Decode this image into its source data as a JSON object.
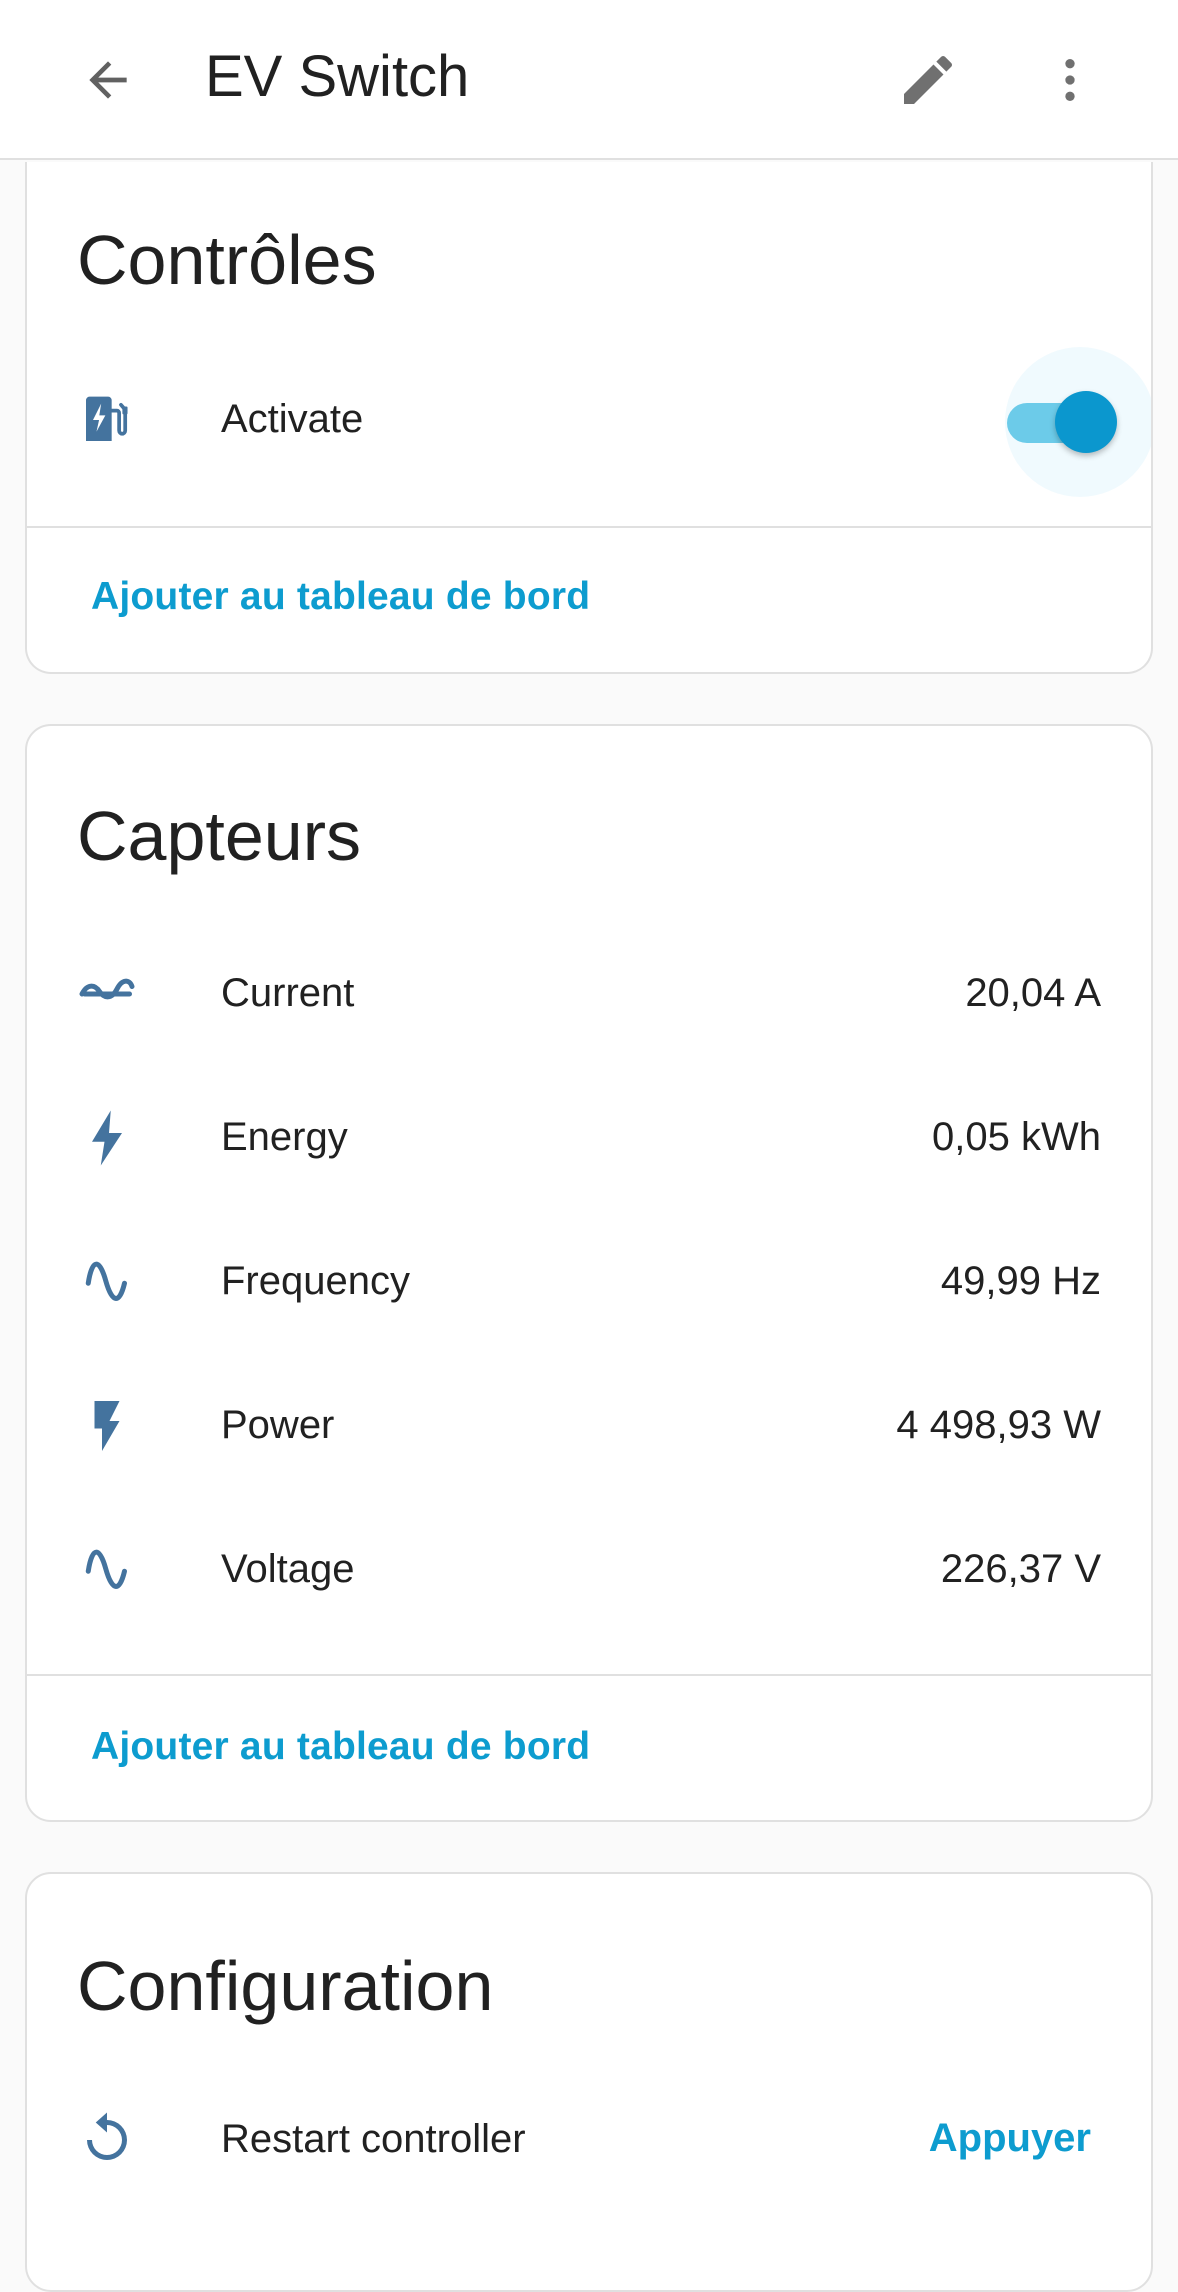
{
  "header": {
    "title": "EV Switch",
    "back_icon": "arrow-left-icon",
    "edit_icon": "pencil-icon",
    "more_icon": "dots-vertical-icon"
  },
  "colors": {
    "accent": "#0d9ccf",
    "icon": "#44739e",
    "toggle_on": "#0b97ce"
  },
  "controls": {
    "title": "Contrôles",
    "items": [
      {
        "icon": "ev-station-icon",
        "label": "Activate",
        "state": "on"
      }
    ],
    "add_link": "Ajouter au tableau de bord"
  },
  "sensors": {
    "title": "Capteurs",
    "items": [
      {
        "icon": "current-ac-icon",
        "label": "Current",
        "value": "20,04 A"
      },
      {
        "icon": "lightning-bolt-icon",
        "label": "Energy",
        "value": "0,05 kWh"
      },
      {
        "icon": "sine-wave-icon",
        "label": "Frequency",
        "value": "49,99 Hz"
      },
      {
        "icon": "flash-icon",
        "label": "Power",
        "value": "4 498,93 W"
      },
      {
        "icon": "sine-wave-icon",
        "label": "Voltage",
        "value": "226,37 V"
      }
    ],
    "add_link": "Ajouter au tableau de bord"
  },
  "configuration": {
    "title": "Configuration",
    "items": [
      {
        "icon": "restart-icon",
        "label": "Restart controller",
        "action": "Appuyer"
      }
    ]
  }
}
